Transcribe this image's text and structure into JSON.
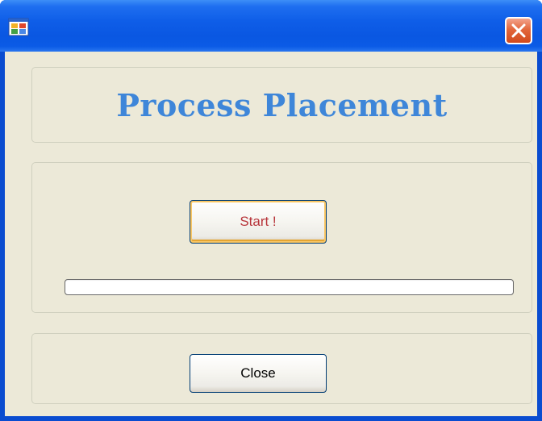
{
  "window": {
    "icon": "app-window-icon",
    "close_icon": "close-icon"
  },
  "header": {
    "title": "Process Placement"
  },
  "actions": {
    "start_label": "Start !",
    "close_label": "Close"
  },
  "progress": {
    "value": 0
  },
  "colors": {
    "title": "#3e86d9",
    "start_text": "#b7343a",
    "background": "#ece9d8",
    "titlebar": "#0a57e2"
  }
}
